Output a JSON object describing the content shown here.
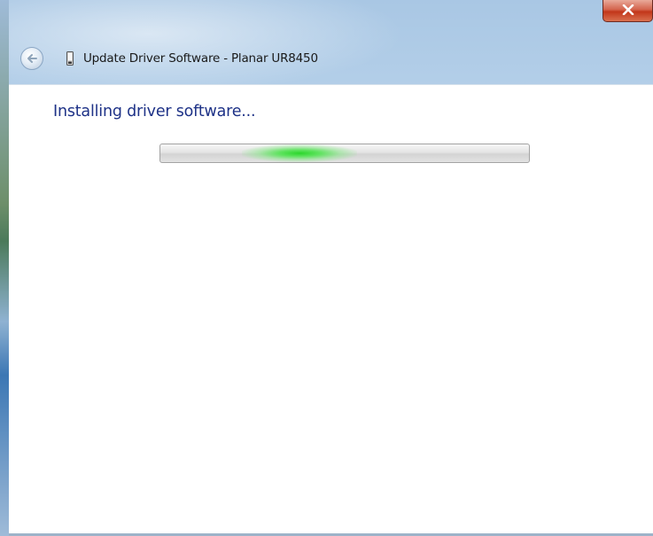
{
  "window": {
    "title": "Update Driver Software - Planar UR8450",
    "close_icon": "close-icon",
    "back_icon": "back-arrow-icon",
    "device_icon": "device-icon"
  },
  "main": {
    "heading": "Installing driver software...",
    "progress": {
      "state": "indeterminate",
      "glow_position": 0.22
    }
  },
  "colors": {
    "heading": "#1e3287",
    "close_button": "#c2361a",
    "progress_glow": "#2bd62b"
  }
}
